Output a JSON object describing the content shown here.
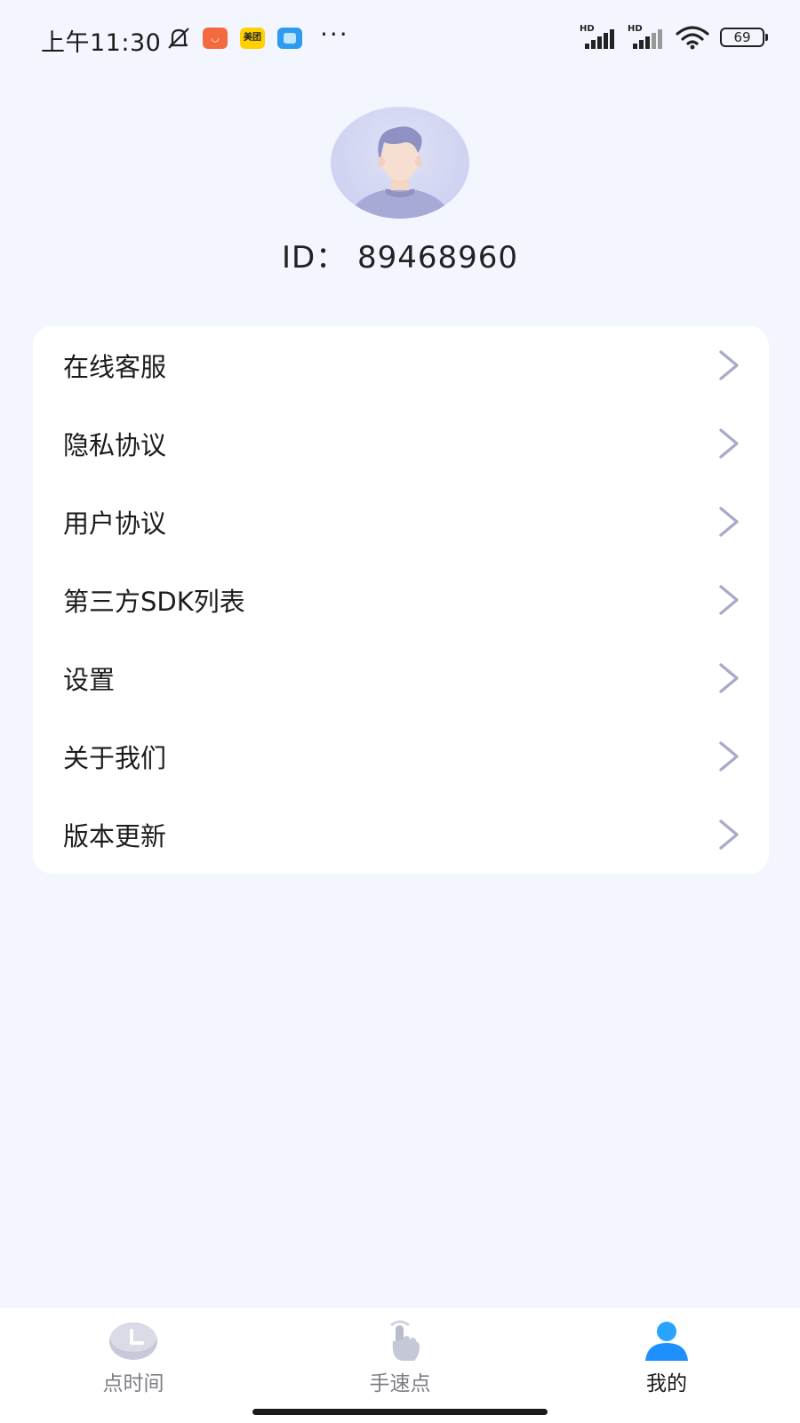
{
  "status_bar": {
    "time": "上午11:30",
    "battery": "69",
    "signal_label": "HD",
    "meituan_label": "美团"
  },
  "profile": {
    "id_text": "ID：  89468960"
  },
  "menu": {
    "items": [
      {
        "label": "在线客服"
      },
      {
        "label": "隐私协议"
      },
      {
        "label": "用户协议"
      },
      {
        "label": "第三方SDK列表"
      },
      {
        "label": "设置"
      },
      {
        "label": "关于我们"
      },
      {
        "label": "版本更新"
      }
    ]
  },
  "bottom_nav": {
    "tabs": [
      {
        "label": "点时间",
        "icon": "clock-icon",
        "active": false
      },
      {
        "label": "手速点",
        "icon": "tap-hand-icon",
        "active": false
      },
      {
        "label": "我的",
        "icon": "person-icon",
        "active": true
      }
    ]
  },
  "colors": {
    "background": "#f3f6fe",
    "card": "#ffffff",
    "accent_blue": "#1e90ff",
    "inactive": "#7e7e85",
    "chevron": "#a9abc9"
  }
}
